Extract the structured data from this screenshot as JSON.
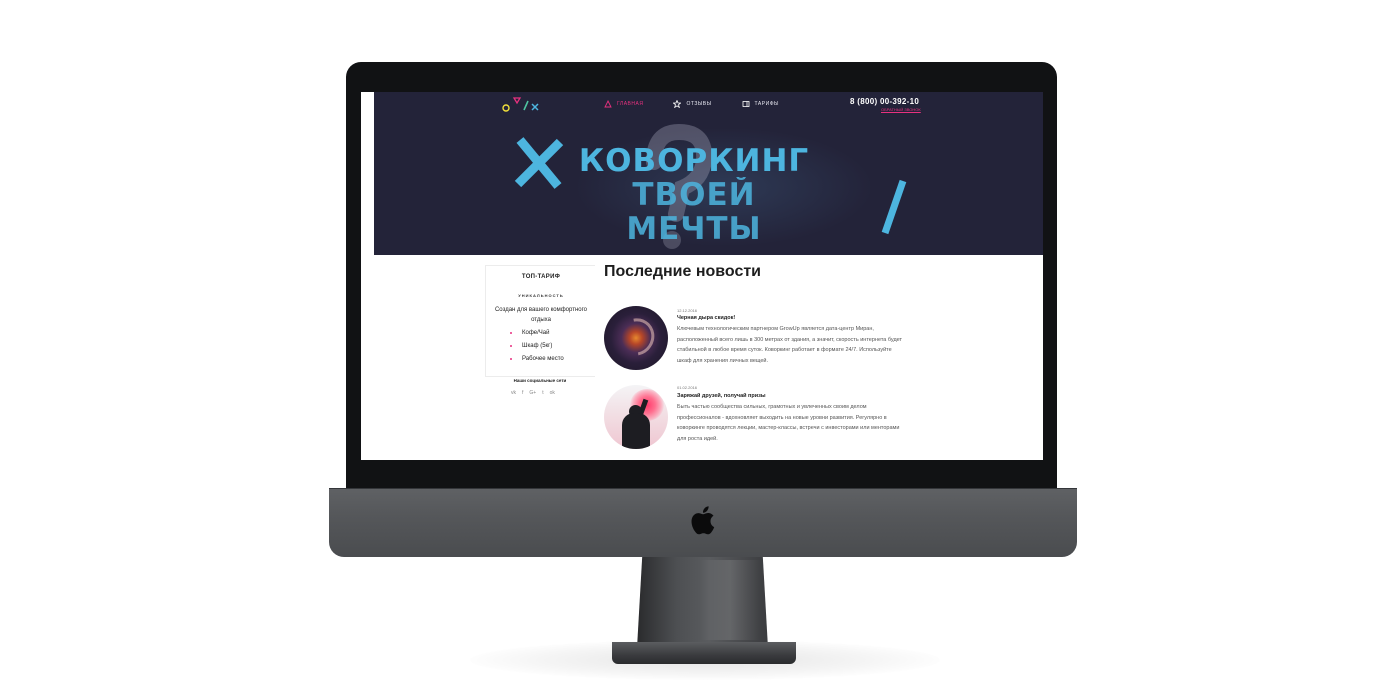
{
  "site": {
    "nav": [
      {
        "label": "ГЛАВНАЯ",
        "icon": "triangle-icon"
      },
      {
        "label": "ОТЗЫВЫ",
        "icon": "star-icon"
      },
      {
        "label": "ТАРИФЫ",
        "icon": "tag-icon"
      }
    ],
    "phone": "8 (800) 00-392-10",
    "callback": "ОБРАТНЫЙ ЗВОНОК",
    "hero": {
      "line1": "Коворкинг",
      "line2": "твоей мечты"
    },
    "sidebar": {
      "title": "ТОП-ТАРИФ",
      "subtitle": "УНИКАЛЬНОСТЬ",
      "description": "Создан для вашего комфортного отдыха",
      "items": [
        "Кофе/Чай",
        "Шкаф (5кг)",
        "Рабочее место"
      ]
    },
    "social": {
      "title": "Наши социальные сети",
      "icons": [
        "vk-icon",
        "facebook-icon",
        "google-plus-icon",
        "twitter-icon",
        "odnoklassniki-icon"
      ],
      "glyphs": [
        "vk",
        "f",
        "G+",
        "t",
        "ok"
      ]
    },
    "news": {
      "heading": "Последние новости",
      "items": [
        {
          "date": "12.12.2016",
          "title": "Черная дыра скидок!",
          "text": "Ключевым технологическим партнером GrowUp является дата-центр Миран, расположенный всего лишь в 300 метрах от здания, а значит, скорость интернета будет стабильной в любое время суток. Коворкинг работает в формате 24/7. Используйте шкаф для хранения личных вещей."
        },
        {
          "date": "01.02.2016",
          "title": "Заряжай друзей, получай призы",
          "text": "Быть частью сообщества сильных, грамотных и увлеченных своим делом профессионалов - вдохновляет выходить на новые уровни развития. Регулярно в коворкинге проводятся лекции, мастер-классы, встречи с инвесторами или менторами для роста идей."
        }
      ]
    }
  },
  "colors": {
    "accent": "#e8317f",
    "hero_bg": "#232339",
    "hero_text": "#4db5df"
  }
}
